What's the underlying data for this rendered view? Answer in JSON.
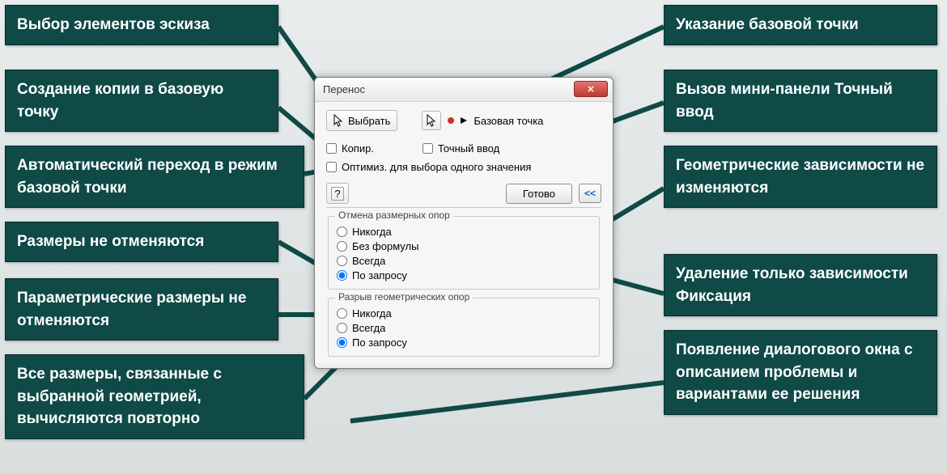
{
  "left_callouts": [
    "Выбор элементов эскиза",
    "Создание копии в базовую точку",
    "Автоматический переход в режим базовой точки",
    "Размеры не отменяются",
    "Параметрические размеры не отменяются",
    "Все  размеры, связанные с выбранной геометрией, вычисляются повторно"
  ],
  "right_callouts": [
    "Указание базовой точки",
    "Вызов мини-панели Точный ввод",
    "Геометрические зависимости не изменяются",
    "Удаление только зависимости Фиксация",
    "Появление диалогового окна с описанием проблемы и вариантами ее решения"
  ],
  "dialog": {
    "title": "Перенос",
    "select_label": "Выбрать",
    "base_point_label": "Базовая точка",
    "checks": {
      "copy": "Копир.",
      "precise": "Точный ввод",
      "optimize": "Оптимиз. для выбора одного значения"
    },
    "help_glyph": "?",
    "done": "Готово",
    "chev": "<<",
    "group1": {
      "title": "Отмена размерных опор",
      "options": [
        "Никогда",
        "Без формулы",
        "Всегда",
        "По запросу"
      ],
      "selected": 3
    },
    "group2": {
      "title": "Разрыв геометрических опор",
      "options": [
        "Никогда",
        "Всегда",
        "По запросу"
      ],
      "selected": 2
    }
  }
}
